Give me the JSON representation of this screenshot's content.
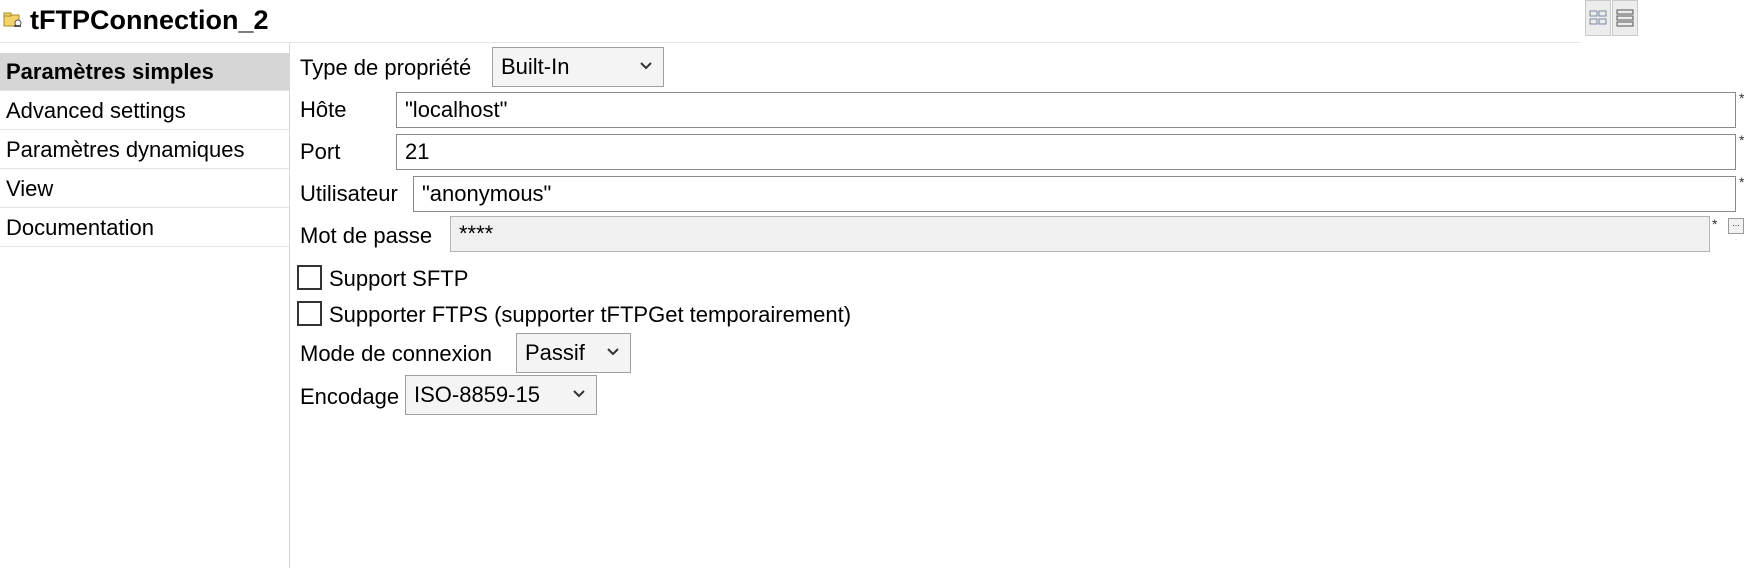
{
  "header": {
    "title": "tFTPConnection_2",
    "icon": "folder-key-icon"
  },
  "sidebar": {
    "items": [
      {
        "label": "Paramètres simples",
        "active": true
      },
      {
        "label": "Advanced settings",
        "active": false
      },
      {
        "label": "Paramètres dynamiques",
        "active": false
      },
      {
        "label": "View",
        "active": false
      },
      {
        "label": "Documentation",
        "active": false
      }
    ]
  },
  "form": {
    "property_type": {
      "label": "Type de propriété",
      "value": "Built-In"
    },
    "host": {
      "label": "Hôte",
      "value": "\"localhost\"",
      "required_mark": "*"
    },
    "port": {
      "label": "Port",
      "value": "21",
      "required_mark": "*"
    },
    "user": {
      "label": "Utilisateur",
      "value": "\"anonymous\"",
      "required_mark": "*"
    },
    "password": {
      "label": "Mot de passe",
      "value": "****",
      "required_mark": "*",
      "button_label": "..."
    },
    "sftp": {
      "label": "Support SFTP",
      "checked": false
    },
    "ftps": {
      "label": "Supporter FTPS (supporter tFTPGet temporairement)",
      "checked": false
    },
    "connection_mode": {
      "label": "Mode de connexion",
      "value": "Passif"
    },
    "encoding": {
      "label": "Encodage",
      "value": "ISO-8859-15"
    }
  },
  "colors": {
    "active_tab_bg": "#d6d6d6",
    "field_border": "#8a8a8a",
    "disabled_field_bg": "#f0f0f0"
  }
}
